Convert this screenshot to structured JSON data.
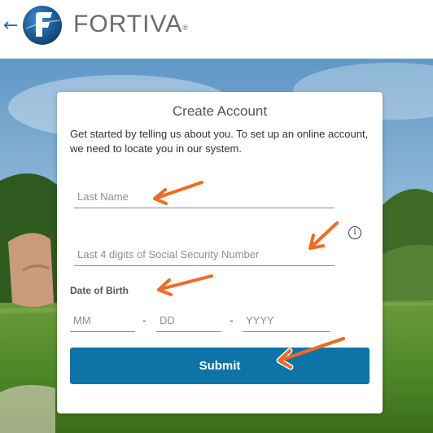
{
  "header": {
    "back_arrow": "←",
    "logo_text": "FORTIVA",
    "logo_reg": "®"
  },
  "form": {
    "title": "Create Account",
    "intro": "Get started by telling us about you. To set up an online account, we need to locate you in our system.",
    "last_name_placeholder": "Last Name",
    "ssn_placeholder": "Last 4 digits of Social Security Number",
    "info_icon_glyph": "i",
    "dob_label": "Date of Birth",
    "mm_placeholder": "MM",
    "dd_placeholder": "DD",
    "yyyy_placeholder": "YYYY",
    "date_separator": "-",
    "submit_label": "Submit"
  },
  "colors": {
    "brand_blue": "#0e74a8",
    "annotation_orange": "#f26a21"
  },
  "icons": [
    "back-arrow-icon",
    "fortiva-logo-icon",
    "info-icon"
  ]
}
